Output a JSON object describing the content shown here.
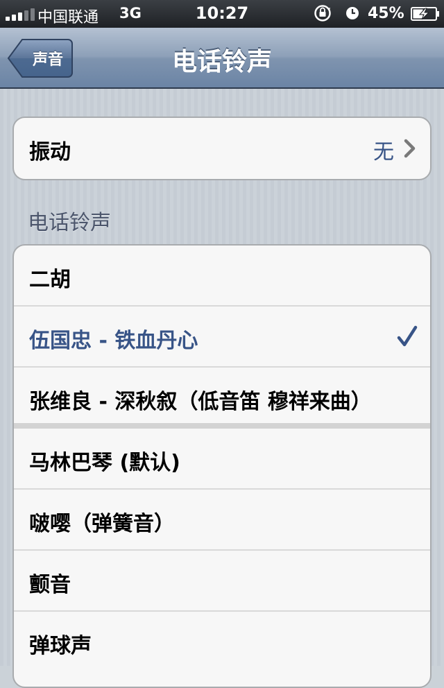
{
  "status_bar": {
    "carrier": "中国联通",
    "network": "3G",
    "time": "10:27",
    "battery": "45%",
    "battery_level": 0.45,
    "signal_bars_active": 3,
    "signal_bars_total": 5
  },
  "navbar": {
    "back_label": "声音",
    "title": "电话铃声"
  },
  "vibration": {
    "label": "振动",
    "value": "无"
  },
  "section_header": "电话铃声",
  "ringtones": [
    {
      "label": "二胡",
      "checked": false
    },
    {
      "label": "伍国忠 - 铁血丹心",
      "checked": true
    },
    {
      "label": "张维良 - 深秋叙（低音笛 穆祥来曲）",
      "checked": false
    },
    {
      "label": "马林巴琴 (默认)",
      "checked": false
    },
    {
      "label": "啵嘤（弹簧音）",
      "checked": false
    },
    {
      "label": "颤音",
      "checked": false
    },
    {
      "label": "弹球声",
      "checked": false
    }
  ],
  "colors": {
    "accent": "#385487",
    "nav_bar": "#7f94af"
  }
}
